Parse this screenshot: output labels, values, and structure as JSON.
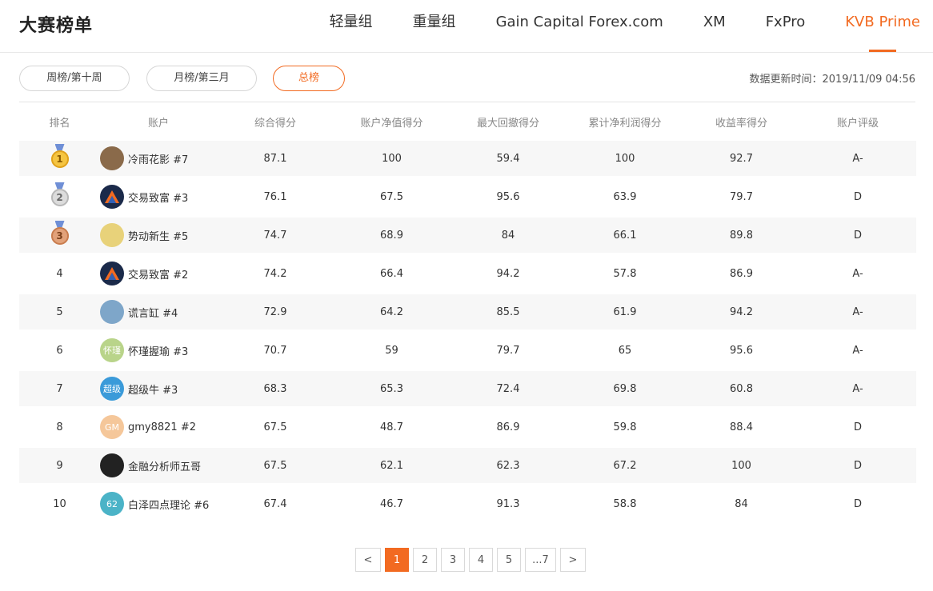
{
  "header": {
    "title": "大赛榜单",
    "tabs": [
      {
        "label": "轻量组",
        "active": false
      },
      {
        "label": "重量组",
        "active": false
      },
      {
        "label": "Gain Capital Forex.com",
        "active": false
      },
      {
        "label": "XM",
        "active": false
      },
      {
        "label": "FxPro",
        "active": false
      },
      {
        "label": "KVB Prime",
        "active": true
      }
    ]
  },
  "filters": {
    "weekly": "周榜/第十周",
    "monthly": "月榜/第三月",
    "total": "总榜",
    "active": "total"
  },
  "update_time": "数据更新时间：2019/11/09 04:56",
  "accent_color": "#f26a21",
  "table": {
    "headers": [
      "排名",
      "账户",
      "综合得分",
      "账户净值得分",
      "最大回撤得分",
      "累计净利润得分",
      "收益率得分",
      "账户评级"
    ],
    "rows": [
      {
        "rank": "1",
        "medal": "gold",
        "avatar_text": "",
        "avatar_color": "#8a6a4a",
        "name": "冷雨花影 #7",
        "total": "87.1",
        "equity": "100",
        "drawdown": "59.4",
        "profit": "100",
        "return": "92.7",
        "grade": "A-"
      },
      {
        "rank": "2",
        "medal": "silver",
        "avatar_text": "",
        "avatar_color": "#1b2a4a",
        "name": "交易致富 #3",
        "total": "76.1",
        "equity": "67.5",
        "drawdown": "95.6",
        "profit": "63.9",
        "return": "79.7",
        "grade": "D"
      },
      {
        "rank": "3",
        "medal": "bronze",
        "avatar_text": "",
        "avatar_color": "#e8d27a",
        "name": "势动新生 #5",
        "total": "74.7",
        "equity": "68.9",
        "drawdown": "84",
        "profit": "66.1",
        "return": "89.8",
        "grade": "D"
      },
      {
        "rank": "4",
        "medal": "",
        "avatar_text": "",
        "avatar_color": "#1b2a4a",
        "name": "交易致富 #2",
        "total": "74.2",
        "equity": "66.4",
        "drawdown": "94.2",
        "profit": "57.8",
        "return": "86.9",
        "grade": "A-"
      },
      {
        "rank": "5",
        "medal": "",
        "avatar_text": "",
        "avatar_color": "#7ea6c9",
        "name": "谎言缸 #4",
        "total": "72.9",
        "equity": "64.2",
        "drawdown": "85.5",
        "profit": "61.9",
        "return": "94.2",
        "grade": "A-"
      },
      {
        "rank": "6",
        "medal": "",
        "avatar_text": "怀瑾",
        "avatar_color": "#b9d48a",
        "name": "怀瑾握瑜 #3",
        "total": "70.7",
        "equity": "59",
        "drawdown": "79.7",
        "profit": "65",
        "return": "95.6",
        "grade": "A-"
      },
      {
        "rank": "7",
        "medal": "",
        "avatar_text": "超级",
        "avatar_color": "#3a9ad9",
        "name": "超级牛 #3",
        "total": "68.3",
        "equity": "65.3",
        "drawdown": "72.4",
        "profit": "69.8",
        "return": "60.8",
        "grade": "A-"
      },
      {
        "rank": "8",
        "medal": "",
        "avatar_text": "GM",
        "avatar_color": "#f5c79a",
        "name": "gmy8821 #2",
        "total": "67.5",
        "equity": "48.7",
        "drawdown": "86.9",
        "profit": "59.8",
        "return": "88.4",
        "grade": "D"
      },
      {
        "rank": "9",
        "medal": "",
        "avatar_text": "",
        "avatar_color": "#222222",
        "name": "金融分析师五哥",
        "total": "67.5",
        "equity": "62.1",
        "drawdown": "62.3",
        "profit": "67.2",
        "return": "100",
        "grade": "D"
      },
      {
        "rank": "10",
        "medal": "",
        "avatar_text": "62",
        "avatar_color": "#4bb3c7",
        "name": "白泽四点理论 #6",
        "total": "67.4",
        "equity": "46.7",
        "drawdown": "91.3",
        "profit": "58.8",
        "return": "84",
        "grade": "D"
      }
    ]
  },
  "pagination": {
    "prev": "<",
    "pages": [
      "1",
      "2",
      "3",
      "4",
      "5",
      "...7"
    ],
    "current": "1",
    "next": ">"
  }
}
